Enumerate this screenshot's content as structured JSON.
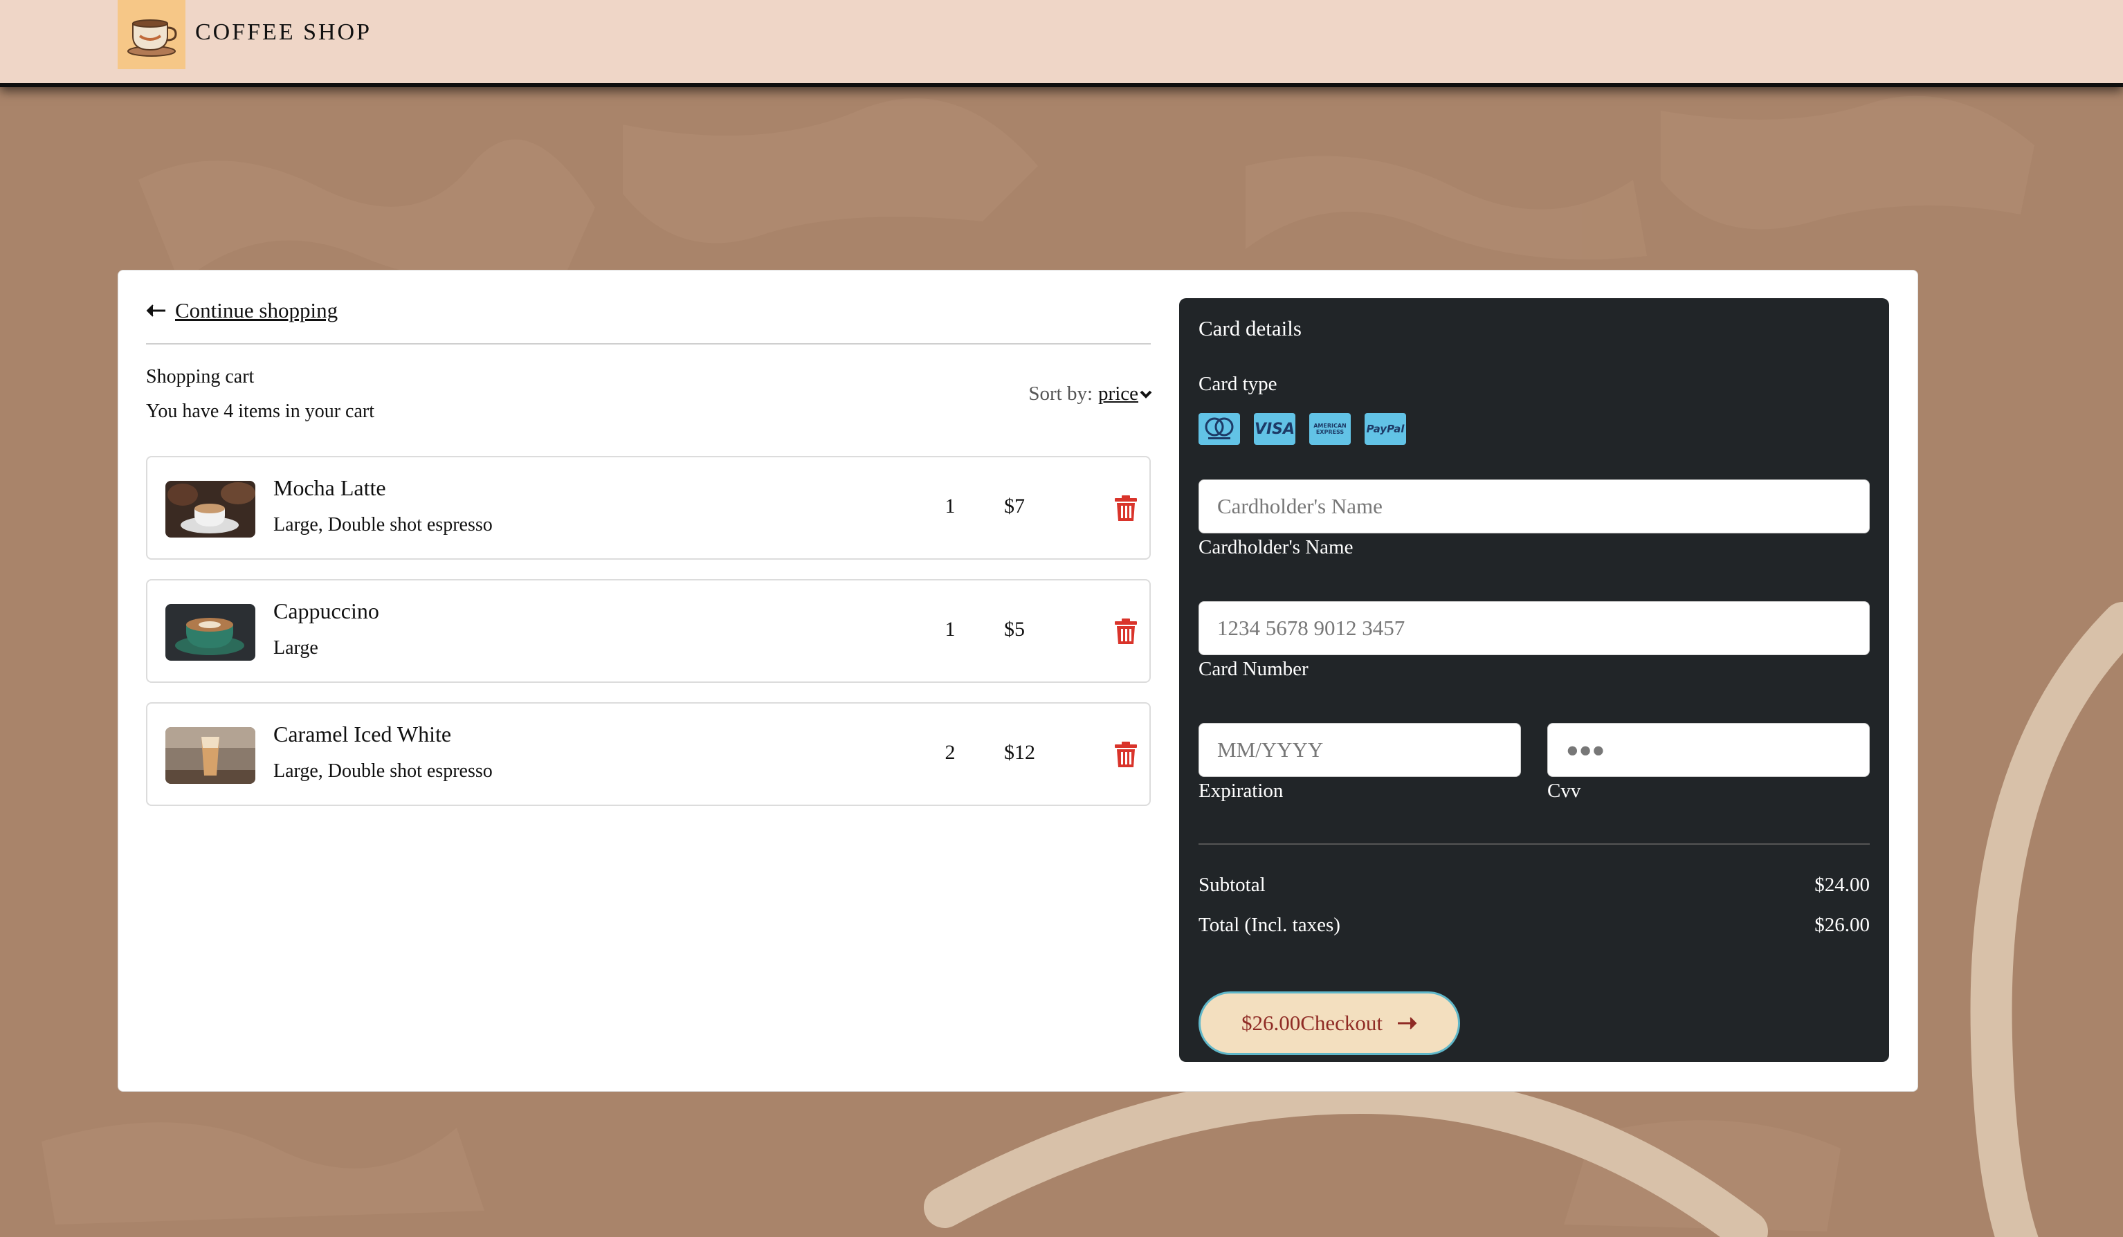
{
  "header": {
    "brand": "COFFEE SHOP",
    "logo_icon": "coffee-cup-icon"
  },
  "cart": {
    "continue_label": "Continue shopping",
    "title": "Shopping cart",
    "count_text": "You have 4 items in your cart",
    "sort_label": "Sort by:",
    "sort_value": "price",
    "items": [
      {
        "name": "Mocha Latte",
        "desc": "Large, Double shot espresso",
        "qty": "1",
        "price": "$7"
      },
      {
        "name": "Cappuccino",
        "desc": "Large",
        "qty": "1",
        "price": "$5"
      },
      {
        "name": "Caramel Iced White",
        "desc": "Large, Double shot espresso",
        "qty": "2",
        "price": "$12"
      }
    ]
  },
  "card": {
    "title": "Card details",
    "card_type_label": "Card type",
    "card_types": [
      "mastercard",
      "VISA",
      "AMERICAN EXPRESS",
      "PayPal"
    ],
    "name_placeholder": "Cardholder's Name",
    "name_label": "Cardholder's Name",
    "number_placeholder": "1234 5678 9012 3457",
    "number_label": "Card Number",
    "expiration_placeholder": "MM/YYYY",
    "expiration_label": "Expiration",
    "cvv_placeholder": "●●●",
    "cvv_label": "Cvv",
    "subtotal_label": "Subtotal",
    "subtotal_value": "$24.00",
    "total_label": "Total (Incl. taxes)",
    "total_value": "$26.00",
    "checkout_amount": "$26.00",
    "checkout_label": "Checkout"
  },
  "colors": {
    "background": "#a9846a",
    "header": "#efd6c7",
    "card_panel": "#212528",
    "delete_red": "#d9342b",
    "checkout_bg": "#f3dfbf"
  }
}
